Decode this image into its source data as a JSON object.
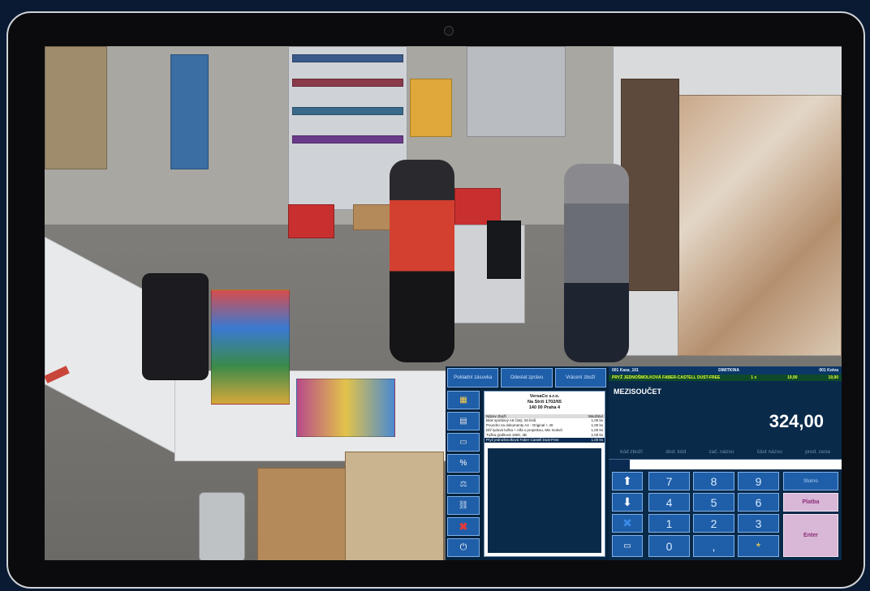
{
  "pos": {
    "toolbar": {
      "buttons": [
        "Pokladní zásuvka",
        "Odeslat zprávu",
        "Vrácení zboží"
      ]
    },
    "receipt": {
      "company": "VersaCo s.r.o.",
      "street": "Na Strži 1702/65",
      "city": "140 00 Praha 4",
      "col_name": "Název zboží",
      "col_qty": "Množství",
      "lines": [
        {
          "name": "Blok spirálový A6 čistý, 50 listů",
          "qty": "1,00 ks"
        },
        {
          "name": "Pouzdro na dokumenty A4 - Original + 40",
          "qty": "1,00 ks"
        },
        {
          "name": "Díl/ lydová tužka + Alfa s propiskou, Mix motivů",
          "qty": "1,00 ks"
        },
        {
          "name": "Tužka grafitová 1500, 3B",
          "qty": "1,00 ks"
        },
        {
          "name": "Pryž jednošmolková Faber Castell Dust-Free",
          "qty": "1,00 ks"
        }
      ]
    },
    "header": {
      "register": "001 Kasa_101",
      "cashier": "DIMITKINA",
      "place": "001 Kotva"
    },
    "current_item": {
      "name": "PRYŽ JEDNOŠMOLKOVÁ FABER-CASTELL DUST-FREE",
      "qty": "1 x",
      "unit_price": "19,90",
      "price": "19,90"
    },
    "subtotal_label": "MEZISOUČET",
    "subtotal_value": "324,00",
    "search_tabs": [
      "kód zboží",
      "dod. kód",
      "zač. názvu",
      "část názvu",
      "prod. cena"
    ],
    "keypad": {
      "digits": [
        "7",
        "8",
        "9",
        "4",
        "5",
        "6",
        "1",
        "2",
        "3",
        "0",
        ",",
        "*"
      ],
      "platba": "Platba",
      "enter": "Enter",
      "extra": "Storno"
    }
  }
}
